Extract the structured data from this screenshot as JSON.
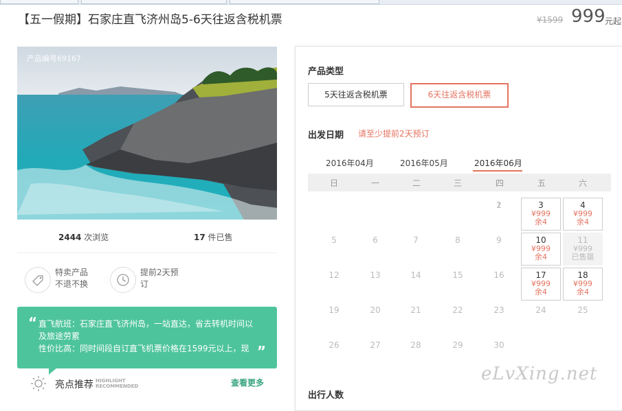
{
  "product": {
    "title": "【五一假期】石家庄直飞济州岛5-6天往返含税机票",
    "old_price": "¥1599",
    "price": "999",
    "price_unit": "元起",
    "code": "产品编号69167"
  },
  "stats": {
    "views_num": "2444",
    "views_label": "次浏览",
    "sold_num": "17",
    "sold_label": "件已售"
  },
  "features": [
    {
      "line1": "特卖产品",
      "line2": "不退不换",
      "icon": "tag-icon"
    },
    {
      "line1": "提前2天预",
      "line2": "订",
      "icon": "clock-icon"
    }
  ],
  "promo": {
    "line1": "直飞航班：石家庄直飞济州岛，一站直达，省去转机时间以及旅途劳累",
    "line2": "性价比高：同时间段自订直飞机票价格在1599元以上，现"
  },
  "highlight": {
    "label": "亮点推荐",
    "en1": "HIGHLIGHT",
    "en2": "RECOMMENDED",
    "more": "查看更多"
  },
  "booking": {
    "type_title": "产品类型",
    "options": [
      "5天往返含税机票",
      "6天往返含税机票"
    ],
    "date_title": "出发日期",
    "date_hint": "请至少提前2天预订",
    "months": [
      "2016年04月",
      "2016年05月",
      "2016年06月"
    ],
    "weekdays": [
      "日",
      "一",
      "二",
      "三",
      "四",
      "五",
      "六"
    ],
    "travelers_title": "出行人数"
  },
  "calendar": {
    "days": [
      {
        "d": "1",
        "c": 4,
        "r": 0
      },
      {
        "d": "2",
        "c": 4,
        "r": 0
      },
      {
        "d": "3",
        "c": 5,
        "r": 0,
        "price": "¥999",
        "stock": "余4"
      },
      {
        "d": "4",
        "c": 6,
        "r": 0,
        "price": "¥999",
        "stock": "余4"
      },
      {
        "d": "5",
        "c": 0,
        "r": 1
      },
      {
        "d": "6",
        "c": 1,
        "r": 1
      },
      {
        "d": "7",
        "c": 2,
        "r": 1
      },
      {
        "d": "8",
        "c": 3,
        "r": 1
      },
      {
        "d": "9",
        "c": 4,
        "r": 1
      },
      {
        "d": "10",
        "c": 5,
        "r": 1,
        "price": "¥999",
        "stock": "余4"
      },
      {
        "d": "11",
        "c": 6,
        "r": 1,
        "price": "¥999",
        "stock": "已售罄",
        "soldout": true
      },
      {
        "d": "12",
        "c": 0,
        "r": 2
      },
      {
        "d": "13",
        "c": 1,
        "r": 2
      },
      {
        "d": "14",
        "c": 2,
        "r": 2
      },
      {
        "d": "15",
        "c": 3,
        "r": 2
      },
      {
        "d": "16",
        "c": 4,
        "r": 2
      },
      {
        "d": "17",
        "c": 5,
        "r": 2,
        "price": "¥999",
        "stock": "余4"
      },
      {
        "d": "18",
        "c": 6,
        "r": 2,
        "price": "¥999",
        "stock": "余4"
      },
      {
        "d": "19",
        "c": 0,
        "r": 3
      },
      {
        "d": "20",
        "c": 1,
        "r": 3
      },
      {
        "d": "21",
        "c": 2,
        "r": 3
      },
      {
        "d": "22",
        "c": 3,
        "r": 3
      },
      {
        "d": "23",
        "c": 4,
        "r": 3
      },
      {
        "d": "24",
        "c": 5,
        "r": 3
      },
      {
        "d": "25",
        "c": 6,
        "r": 3
      },
      {
        "d": "26",
        "c": 0,
        "r": 4
      },
      {
        "d": "27",
        "c": 1,
        "r": 4
      },
      {
        "d": "28",
        "c": 2,
        "r": 4
      },
      {
        "d": "29",
        "c": 3,
        "r": 4
      },
      {
        "d": "30",
        "c": 4,
        "r": 4
      }
    ]
  },
  "watermark": "eLvXing.net",
  "colors": {
    "accent": "#e4735f",
    "green": "#4ec49d"
  }
}
